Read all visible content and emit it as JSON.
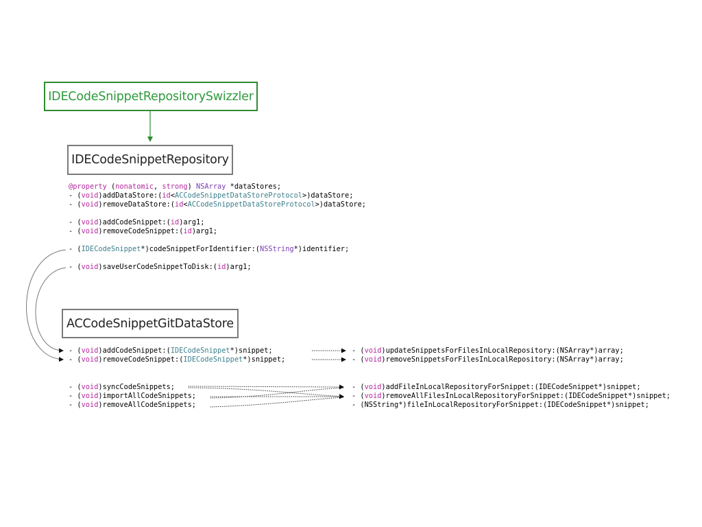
{
  "boxes": {
    "swizzler": "IDECodeSnippetRepositorySwizzler",
    "repository": "IDECodeSnippetRepository",
    "git_data_store": "ACCodeSnippetGitDataStore"
  },
  "repository_methods": [
    [
      [
        "@property",
        "kw"
      ],
      [
        " (",
        ""
      ],
      [
        "nonatomic",
        "kw"
      ],
      [
        ", ",
        ""
      ],
      [
        "strong",
        "kw"
      ],
      [
        ") ",
        ""
      ],
      [
        "NSArray",
        "cl"
      ],
      [
        " *dataStores;",
        ""
      ]
    ],
    [
      [
        "- (",
        ""
      ],
      [
        "void",
        "kw"
      ],
      [
        ")addDataStore:(",
        ""
      ],
      [
        "id",
        "kw"
      ],
      [
        "<",
        ""
      ],
      [
        "ACCodeSnippetDataStoreProtocol",
        "ty"
      ],
      [
        ">)dataStore;",
        ""
      ]
    ],
    [
      [
        "- (",
        ""
      ],
      [
        "void",
        "kw"
      ],
      [
        ")removeDataStore:(",
        ""
      ],
      [
        "id",
        "kw"
      ],
      [
        "<",
        ""
      ],
      [
        "ACCodeSnippetDataStoreProtocol",
        "ty"
      ],
      [
        ">)dataStore;",
        ""
      ]
    ],
    [],
    [
      [
        "- (",
        ""
      ],
      [
        "void",
        "kw"
      ],
      [
        ")addCodeSnippet:(",
        ""
      ],
      [
        "id",
        "kw"
      ],
      [
        ")arg1;",
        ""
      ]
    ],
    [
      [
        "- (",
        ""
      ],
      [
        "void",
        "kw"
      ],
      [
        ")removeCodeSnippet:(",
        ""
      ],
      [
        "id",
        "kw"
      ],
      [
        ")arg1;",
        ""
      ]
    ],
    [],
    [
      [
        "- (",
        ""
      ],
      [
        "IDECodeSnippet",
        "ty"
      ],
      [
        "*)codeSnippetForIdentifier:(",
        ""
      ],
      [
        "NSString",
        "cl"
      ],
      [
        "*)identifier;",
        ""
      ]
    ],
    [],
    [
      [
        "- (",
        ""
      ],
      [
        "void",
        "kw"
      ],
      [
        ")saveUserCodeSnippetToDisk:(",
        ""
      ],
      [
        "id",
        "kw"
      ],
      [
        ")arg1;",
        ""
      ]
    ]
  ],
  "git_snippet_methods": [
    [
      [
        "- (",
        ""
      ],
      [
        "void",
        "kw"
      ],
      [
        ")addCodeSnippet:(",
        ""
      ],
      [
        "IDECodeSnippet",
        "ty"
      ],
      [
        "*)snippet;",
        ""
      ]
    ],
    [
      [
        "- (",
        ""
      ],
      [
        "void",
        "kw"
      ],
      [
        ")removeCodeSnippet:(",
        ""
      ],
      [
        "IDECodeSnippet",
        "ty"
      ],
      [
        "*)snippet;",
        ""
      ]
    ]
  ],
  "git_repo_methods": [
    [
      [
        "- (",
        ""
      ],
      [
        "void",
        "kw"
      ],
      [
        ")updateSnippetsForFilesInLocalRepository:(NSArray*)array;",
        ""
      ]
    ],
    [
      [
        "- (",
        ""
      ],
      [
        "void",
        "kw"
      ],
      [
        ")removeSnippetsForFilesInLocalRepository:(NSArray*)array;",
        ""
      ]
    ]
  ],
  "sync_methods": [
    [
      [
        "- (",
        ""
      ],
      [
        "void",
        "kw"
      ],
      [
        ")syncCodeSnippets;",
        ""
      ]
    ],
    [
      [
        "- (",
        ""
      ],
      [
        "void",
        "kw"
      ],
      [
        ")importAllCodeSnippets;",
        ""
      ]
    ],
    [
      [
        "- (",
        ""
      ],
      [
        "void",
        "kw"
      ],
      [
        ")removeAllCodeSnippets;",
        ""
      ]
    ]
  ],
  "file_methods": [
    [
      [
        "- (",
        ""
      ],
      [
        "void",
        "kw"
      ],
      [
        ")addFileInLocalRepositoryForSnippet:(IDECodeSnippet*)snippet;",
        ""
      ]
    ],
    [
      [
        "- (",
        ""
      ],
      [
        "void",
        "kw"
      ],
      [
        ")removeAllFilesInLocalRepositoryForSnippet:(IDECodeSnippet*)snippet;",
        ""
      ]
    ],
    [
      [
        "- (NSString*)fileInLocalRepositoryForSnippet:(IDECodeSnippet*)snippet;",
        ""
      ]
    ]
  ],
  "colors": {
    "swizzler": "#2e9a3c",
    "keyword": "#b5289e",
    "type": "#3c7f8c",
    "class": "#7a3eb3",
    "box_border": "#7a7a7a"
  }
}
